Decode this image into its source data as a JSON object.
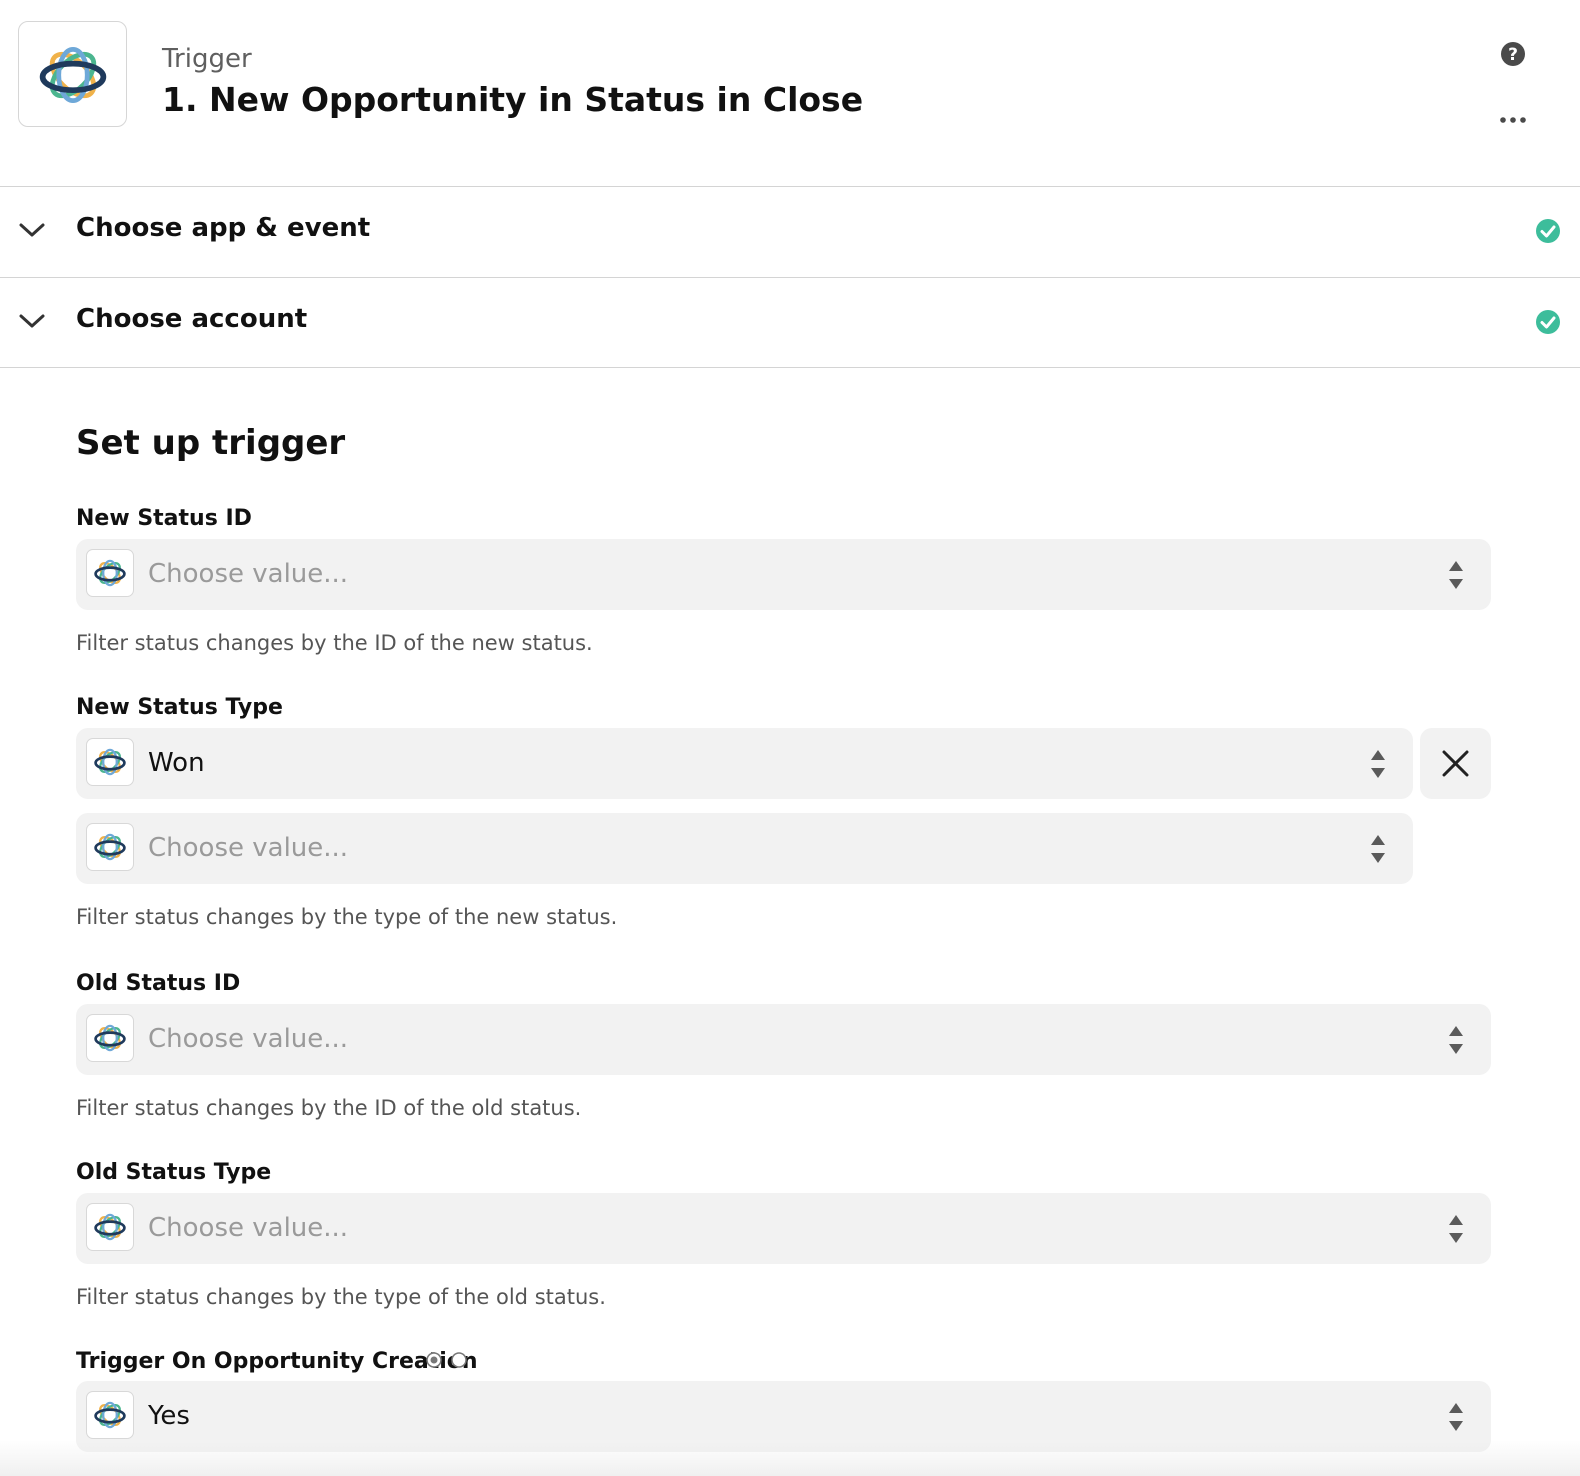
{
  "header": {
    "kicker": "Trigger",
    "title": "1. New Opportunity in Status in Close"
  },
  "sections": [
    {
      "label": "Choose app & event",
      "complete": true
    },
    {
      "label": "Choose account",
      "complete": true
    }
  ],
  "setup": {
    "title": "Set up trigger",
    "fields": {
      "new_status_id": {
        "label": "New Status ID",
        "value": "Choose value...",
        "help": "Filter status changes by the ID of the new status."
      },
      "new_status_type": {
        "label": "New Status Type",
        "value": "Won",
        "extra_value": "Choose value...",
        "help": "Filter status changes by the type of the new status."
      },
      "old_status_id": {
        "label": "Old Status ID",
        "value": "Choose value...",
        "help": "Filter status changes by the ID of the old status."
      },
      "old_status_type": {
        "label": "Old Status Type",
        "value": "Choose value...",
        "help": "Filter status changes by the type of the old status."
      },
      "trigger_on_creation": {
        "label": "Trigger On Opportunity Creation",
        "value": "Yes"
      }
    }
  },
  "icons": {
    "app_logo": "close-logo-icon",
    "help": "help-icon",
    "more": "more-options-icon",
    "chevron": "chevron-down-icon",
    "check": "check-circle-icon",
    "arrows": "select-arrows-icon",
    "clear": "close-icon"
  },
  "colors": {
    "success": "#3dbd9b",
    "field_bg": "#f2f2f2",
    "placeholder": "#9a9a9a"
  }
}
